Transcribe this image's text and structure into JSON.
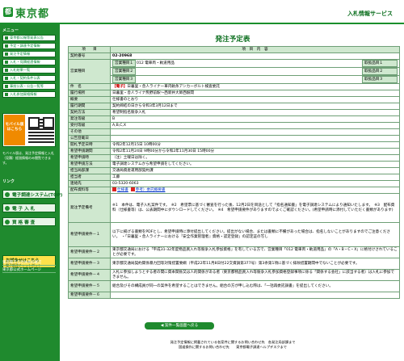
{
  "header": {
    "logo_mark": "都",
    "logo_text": "東京都",
    "service": "入札情報サービス"
  },
  "sidebar": {
    "menu_heading": "メニュー",
    "items": [
      "東京都公報等発表公告",
      "予定・調達予定情報",
      "発注予定情報",
      "入札・見積経過情報",
      "入札結果一覧",
      "入札・契約条件公表",
      "事前公表・公告一覧等",
      "入札参加資格情報"
    ],
    "mobile_label": "モバイル版はこちら",
    "mobile_note": "モバイル版は、発注予定情報と入札（見積）経過情報のみ閲覧できます。",
    "links_heading": "リンク",
    "big_links": [
      "電子調達システム(TOP)",
      "電 子 入 札",
      "資 格 審 査"
    ],
    "cart_title": "お試会せはこちら",
    "cart_sub": "電子調達チャットボット",
    "bottom_links": [
      "東京電子自治体共同運営",
      "東京都公式ホームページ"
    ]
  },
  "main": {
    "title": "発注予定表",
    "col_item": "項　　目",
    "col_content": "項　目　内　容",
    "contract_no_label": "契約番号",
    "contract_no": "02-20968",
    "business_label": "営業種目",
    "business_items": [
      "営業種目１",
      "営業種目２",
      "営業種目３"
    ],
    "business_values": [
      "012 電車両・軌道用品",
      "",
      ""
    ],
    "product_items": [
      "取扱品目１",
      "取扱品目２",
      "取扱品目３"
    ],
    "subject_label": "件　名",
    "subject_tag": "【電子】",
    "subject": "日暮里・舎人ライナー車内軌条アンカーボルト検査委託",
    "place_label": "履行場所",
    "place": "日暮里・舎人ライナ熊野前駅～西新井大師西駅間",
    "summary_label": "概要",
    "summary": "仕様書のとおり",
    "period_label": "履行期間",
    "period": "契約締結の日から令和3年3月12日まで",
    "method_label": "契約方法",
    "method": "希望制指名競争入札",
    "rank_label": "発注等級",
    "rank": "B",
    "accept_rank_label": "受付等級",
    "accept_rank": "A,B,C,X",
    "other_label": "その他",
    "announce_label": "公告登載日",
    "announce": "",
    "start_label": "開札予定日時",
    "start": "令和2年12月15日 10時00分",
    "apply_period_label": "希望申請期間",
    "apply_period": "令和2年11月24日 9時00分から令和2年11月30日 15時00分",
    "apply_note_label": "希望申請時",
    "apply_note": "（注）土曜日は除く。",
    "apply_method_label": "希望申請方法",
    "apply_method": "電子調達システムから希望申請をしてください。",
    "dept_label": "担当局部課",
    "dept": "交通局資産運用部契約課",
    "person_label": "担当者",
    "person": "工藤",
    "contact_label": "連絡先",
    "contact": "03-5320-6063",
    "docs_label": "配布資料等",
    "docs": [
      "仕様書",
      "参考）委託概要書"
    ],
    "remarks_label": "発注予定備考",
    "remarks": "※1　本件は、電子入札案件です。　※2　希望票に基づく審査を行った後、12月2日を目途として「指名通知書」を電子調達システムにより通知いたします。　※3　配布資料（仕様書等）は、公表期間中にダウンロードしてください。　※4　希望申請要件がありますのでよくご確認ください。(希望申請時に添付していただく書類があります)",
    "req_labels": [
      "希望申請要件－１",
      "希望申請要件－２",
      "希望申請要件－３",
      "希望申請要件－４",
      "希望申請要件－５",
      "希望申請要件－６"
    ],
    "req_values": [
      "以下に掲げる書類をPDFとし、希望申請時に添付提出してください。提出がない場合、または書類に不備があった場合は、指名しないことがありますのでご注意ください。　・「日暮里・舎人ライナーにおける『安全作業管理者』資格・認定登録」の認定証の写し",
      "東京都交通局における「平成31-32年度物品買入れ等競争入札参加資格」を有している方で、営業種目「012 電車両・軌道用品」の「A・B・C・X」に格付けされていることが必要です。",
      "東京都交通局契約関係暴力団等対策措置要綱（平成22年11月8日付22交資調第377号）第3条第1項に基づく排除措置期間中でないことが必要です。",
      "入札に参加しようとする者の間に資本関係又は人的関係がある者（東京都物品買入れ等競争入札参加資格登録事項に係る「関係する会社」に該当する者）は入札に参加できません。",
      "組合及びその構成員が同一の案件を希望することはできません。組合の方が申し込む際は、「一括再委託調書」を提出してください。",
      ""
    ],
    "back_button": "案件一覧画面へ戻る"
  },
  "footer": {
    "line1": "発注予定情報に掲載されている各案件に関するお問い合わせ先　各発注局部課まで",
    "line2": "国道操作に関するお問い合わせ先　　東京都電子調達ヘルプデスクまで"
  },
  "colors": {
    "brand_green": "#1f8a2e",
    "header_cell": "#cfe8cf",
    "subject_red": "#cc0000"
  }
}
